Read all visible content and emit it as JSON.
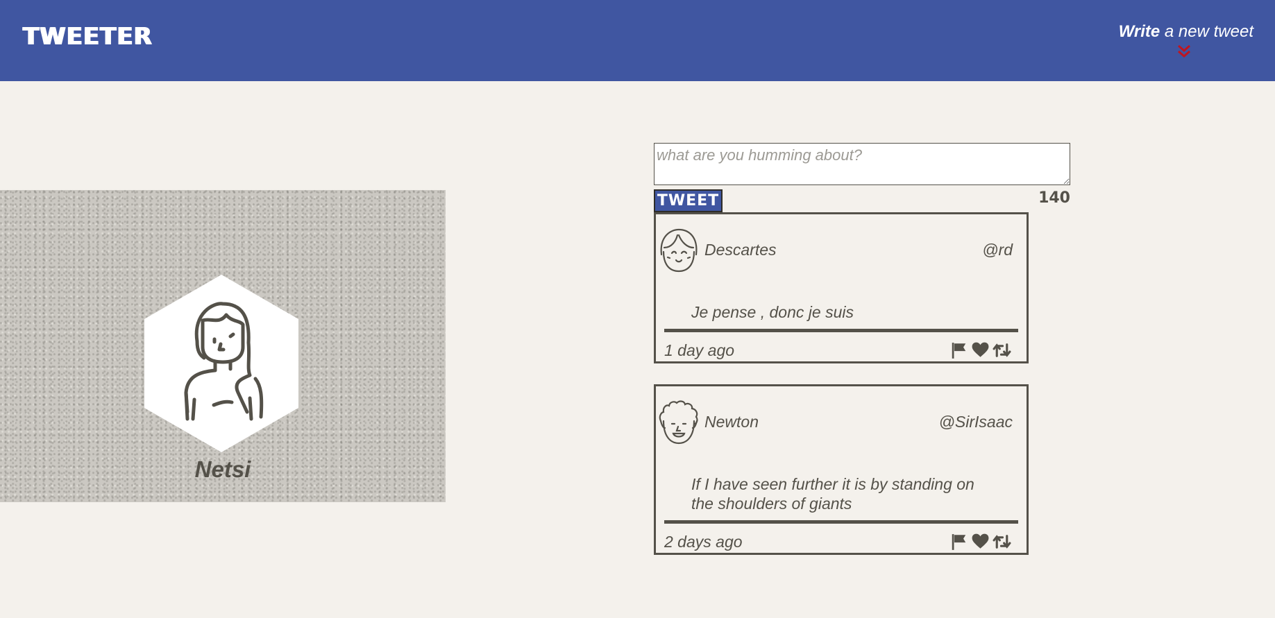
{
  "nav": {
    "brand": "TWEETER",
    "compose_bold": "Write",
    "compose_rest": " a new tweet",
    "chevron_color": "#c0151f"
  },
  "profile": {
    "name": "Netsi",
    "avatar_icon": "woman-avatar-icon"
  },
  "composer": {
    "placeholder": "what are you humming about?",
    "button_label": "TWEET",
    "counter": "140"
  },
  "colors": {
    "nav_bg": "#4056a1",
    "page_bg": "#f4f1ec",
    "text": "#545149"
  },
  "tweets": [
    {
      "name": "Descartes",
      "handle": "@rd",
      "body": "Je pense , donc je suis",
      "time": "1 day ago",
      "avatar_icon": "smiling-girl-avatar-icon"
    },
    {
      "name": "Newton",
      "handle": "@SirIsaac",
      "body": "If I have seen further it is by standing on the shoulders of giants",
      "time": "2 days ago",
      "avatar_icon": "curly-hair-man-avatar-icon"
    }
  ],
  "action_icons": [
    "flag-icon",
    "heart-icon",
    "retweet-icon"
  ]
}
